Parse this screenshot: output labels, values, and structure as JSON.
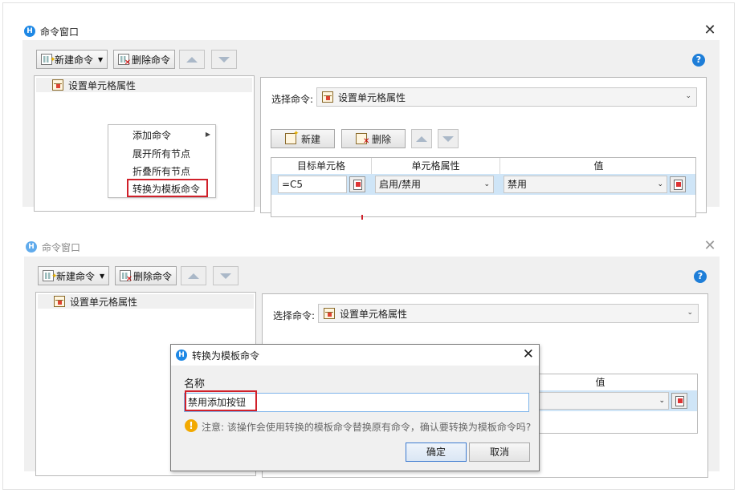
{
  "top": {
    "window_title": "命令窗口",
    "new_command": "新建命令",
    "delete_command": "删除命令",
    "help": "?",
    "tree_node": "设置单元格属性",
    "context_menu": [
      "添加命令",
      "展开所有节点",
      "折叠所有节点",
      "转换为模板命令"
    ],
    "select_label": "选择命令:",
    "select_value": "设置单元格属性",
    "new_btn": "新建",
    "delete_btn": "删除",
    "grid": {
      "headers": [
        "目标单元格",
        "单元格属性",
        "值"
      ],
      "row": {
        "target": "=C5",
        "property": "启用/禁用",
        "value": "禁用"
      }
    }
  },
  "bottom": {
    "window_title": "命令窗口",
    "new_command": "新建命令",
    "delete_command": "删除命令",
    "help": "?",
    "tree_node": "设置单元格属性",
    "select_label": "选择命令:",
    "select_value": "设置单元格属性",
    "grid_value_header": "值",
    "dialog": {
      "title": "转换为模板命令",
      "name_label": "名称",
      "name_value": "禁用添加按钮",
      "warning": "注意: 该操作会使用转换的模板命令替换原有命令，确认要转换为模板命令吗?",
      "ok": "确定",
      "cancel": "取消"
    }
  },
  "colors": {
    "accent_red": "#d0202a",
    "app_blue": "#1e88e5",
    "selected_row": "#cfe5f7"
  }
}
